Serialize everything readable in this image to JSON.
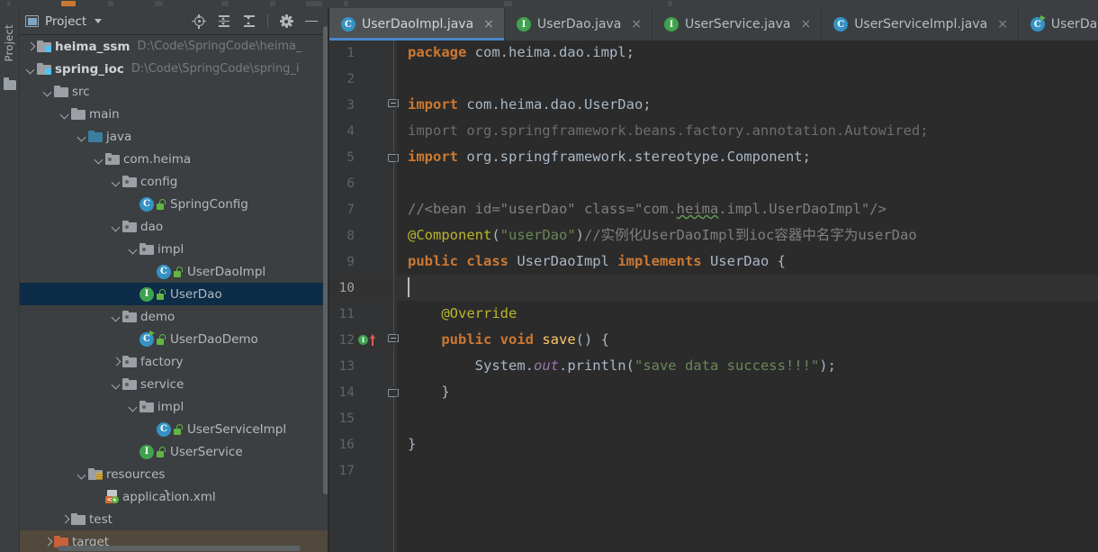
{
  "app": {
    "tool_window_label": "Project"
  },
  "project_panel": {
    "title": "Project",
    "toolbar": [
      {
        "name": "locate-in-tree-icon",
        "label": "Select Opened File"
      },
      {
        "name": "expand-all-icon",
        "label": "Expand All"
      },
      {
        "name": "collapse-all-icon",
        "label": "Collapse All"
      },
      {
        "name": "gear-icon",
        "label": "Settings"
      },
      {
        "name": "minimize-icon",
        "label": "Hide"
      }
    ],
    "tree": [
      {
        "indent": 0,
        "arrow": "right",
        "icon": "module-folder",
        "label": "heima_ssm",
        "bold": true,
        "path": "D:\\Code\\SpringCode\\heima_"
      },
      {
        "indent": 0,
        "arrow": "down",
        "icon": "module-folder",
        "label": "spring_ioc",
        "bold": true,
        "path": "D:\\Code\\SpringCode\\spring_i"
      },
      {
        "indent": 1,
        "arrow": "down",
        "icon": "folder",
        "label": "src",
        "bold": false,
        "path": ""
      },
      {
        "indent": 2,
        "arrow": "down",
        "icon": "folder",
        "label": "main",
        "bold": false,
        "path": ""
      },
      {
        "indent": 3,
        "arrow": "down",
        "icon": "source-folder",
        "label": "java",
        "bold": false,
        "path": ""
      },
      {
        "indent": 4,
        "arrow": "down",
        "icon": "package",
        "label": "com.heima",
        "bold": false,
        "path": ""
      },
      {
        "indent": 5,
        "arrow": "down",
        "icon": "package",
        "label": "config",
        "bold": false,
        "path": ""
      },
      {
        "indent": 6,
        "arrow": "none",
        "icon": "java-class",
        "label": "SpringConfig",
        "bold": false,
        "path": ""
      },
      {
        "indent": 5,
        "arrow": "down",
        "icon": "package",
        "label": "dao",
        "bold": false,
        "path": ""
      },
      {
        "indent": 6,
        "arrow": "down",
        "icon": "package",
        "label": "impl",
        "bold": false,
        "path": ""
      },
      {
        "indent": 7,
        "arrow": "none",
        "icon": "java-class",
        "label": "UserDaoImpl",
        "bold": false,
        "path": ""
      },
      {
        "indent": 6,
        "arrow": "none",
        "icon": "java-interface",
        "label": "UserDao",
        "bold": false,
        "path": "",
        "selected": true
      },
      {
        "indent": 5,
        "arrow": "down",
        "icon": "package",
        "label": "demo",
        "bold": false,
        "path": ""
      },
      {
        "indent": 6,
        "arrow": "none",
        "icon": "java-runnable-class",
        "label": "UserDaoDemo",
        "bold": false,
        "path": ""
      },
      {
        "indent": 5,
        "arrow": "right",
        "icon": "package",
        "label": "factory",
        "bold": false,
        "path": ""
      },
      {
        "indent": 5,
        "arrow": "down",
        "icon": "package",
        "label": "service",
        "bold": false,
        "path": ""
      },
      {
        "indent": 6,
        "arrow": "down",
        "icon": "package",
        "label": "impl",
        "bold": false,
        "path": ""
      },
      {
        "indent": 7,
        "arrow": "none",
        "icon": "java-class",
        "label": "UserServiceImpl",
        "bold": false,
        "path": ""
      },
      {
        "indent": 6,
        "arrow": "none",
        "icon": "java-interface",
        "label": "UserService",
        "bold": false,
        "path": ""
      },
      {
        "indent": 3,
        "arrow": "down",
        "icon": "resources-folder",
        "label": "resources",
        "bold": false,
        "path": ""
      },
      {
        "indent": 4,
        "arrow": "none",
        "icon": "xml-file",
        "label": "application.xml",
        "bold": false,
        "path": ""
      },
      {
        "indent": 2,
        "arrow": "right",
        "icon": "folder",
        "label": "test",
        "bold": false,
        "path": ""
      },
      {
        "indent": 1,
        "arrow": "right",
        "icon": "excluded-folder",
        "label": "target",
        "bold": false,
        "path": "",
        "excluded": true
      }
    ]
  },
  "editor": {
    "tabs": [
      {
        "icon": "java-class",
        "label": "UserDaoImpl.java",
        "close": "×",
        "active": true
      },
      {
        "icon": "java-interface",
        "label": "UserDao.java",
        "close": "×",
        "active": false
      },
      {
        "icon": "java-interface",
        "label": "UserService.java",
        "close": "×",
        "active": false
      },
      {
        "icon": "java-class",
        "label": "UserServiceImpl.java",
        "close": "×",
        "active": false
      },
      {
        "icon": "java-runnable-class",
        "label": "UserDaoDe",
        "close": "",
        "active": false
      }
    ],
    "line_numbers": [
      "1",
      "2",
      "3",
      "4",
      "5",
      "6",
      "7",
      "8",
      "9",
      "10",
      "11",
      "12",
      "13",
      "14",
      "15",
      "16",
      "17"
    ],
    "current_line": 10,
    "gutter_markers": [
      {
        "line": 12,
        "name": "implements-method-marker",
        "glyph": "I"
      }
    ],
    "code_lines": [
      {
        "n": 1,
        "segments": [
          {
            "t": "package",
            "c": "kw-b"
          },
          {
            "t": " com.heima.dao.impl;",
            "c": "id"
          }
        ]
      },
      {
        "n": 2,
        "segments": []
      },
      {
        "n": 3,
        "segments": [
          {
            "t": "import",
            "c": "kw-b"
          },
          {
            "t": " com.heima.dao.UserDao;",
            "c": "id"
          }
        ]
      },
      {
        "n": 4,
        "segments": [
          {
            "t": "import org.springframework.beans.factory.annotation.Autowired;",
            "c": "dim"
          }
        ]
      },
      {
        "n": 5,
        "segments": [
          {
            "t": "import",
            "c": "kw-b"
          },
          {
            "t": " org.springframework.stereotype.",
            "c": "id"
          },
          {
            "t": "Component",
            "c": "cls-n"
          },
          {
            "t": ";",
            "c": "id"
          }
        ]
      },
      {
        "n": 6,
        "segments": []
      },
      {
        "n": 7,
        "segments": [
          {
            "t": "//<bean id=\"userDao\" class=\"com.",
            "c": "cmt"
          },
          {
            "t": "heima",
            "c": "cmt squig"
          },
          {
            "t": ".impl.UserDaoImpl\"/>",
            "c": "cmt"
          }
        ]
      },
      {
        "n": 8,
        "segments": [
          {
            "t": "@Component",
            "c": "ann"
          },
          {
            "t": "(",
            "c": "punc"
          },
          {
            "t": "\"userDao\"",
            "c": "str"
          },
          {
            "t": ")",
            "c": "punc"
          },
          {
            "t": "//实例化UserDaoImpl到ioc容器中名字为userDao",
            "c": "cmt"
          }
        ]
      },
      {
        "n": 9,
        "segments": [
          {
            "t": "public class",
            "c": "kw-b"
          },
          {
            "t": " UserDaoImpl ",
            "c": "id"
          },
          {
            "t": "implements",
            "c": "kw-b"
          },
          {
            "t": " UserDao {",
            "c": "id"
          }
        ]
      },
      {
        "n": 10,
        "segments": []
      },
      {
        "n": 11,
        "segments": [
          {
            "t": "    @Override",
            "c": "ann"
          }
        ]
      },
      {
        "n": 12,
        "segments": [
          {
            "t": "    ",
            "c": "id"
          },
          {
            "t": "public void",
            "c": "kw-b"
          },
          {
            "t": " ",
            "c": "id"
          },
          {
            "t": "save",
            "c": "meth"
          },
          {
            "t": "() {",
            "c": "id"
          }
        ]
      },
      {
        "n": 13,
        "segments": [
          {
            "t": "        System.",
            "c": "id"
          },
          {
            "t": "out",
            "c": "stat"
          },
          {
            "t": ".println(",
            "c": "id"
          },
          {
            "t": "\"save data success!!!\"",
            "c": "str"
          },
          {
            "t": ");",
            "c": "id"
          }
        ]
      },
      {
        "n": 14,
        "segments": [
          {
            "t": "    }",
            "c": "id"
          }
        ]
      },
      {
        "n": 15,
        "segments": []
      },
      {
        "n": 16,
        "segments": [
          {
            "t": "}",
            "c": "id"
          }
        ]
      },
      {
        "n": 17,
        "segments": []
      }
    ],
    "fold_markers": [
      {
        "line": 3,
        "type": "start"
      },
      {
        "line": 5,
        "type": "end"
      },
      {
        "line": 12,
        "type": "start"
      },
      {
        "line": 14,
        "type": "end"
      }
    ]
  },
  "colors": {
    "panel_bg": "#3c3f41",
    "editor_bg": "#2b2b2b",
    "gutter_bg": "#313335",
    "selection_bg": "#0d2c47",
    "active_tab_bg": "#4e5254",
    "active_tab_underline": "#4a88c7",
    "keyword": "#cc7832",
    "string": "#6a8759",
    "annotation": "#bbb529",
    "comment": "#808080",
    "method": "#ffc66d",
    "static_field": "#9876aa",
    "identifier": "#a9b7c6",
    "excluded_folder": "#c9603a"
  }
}
